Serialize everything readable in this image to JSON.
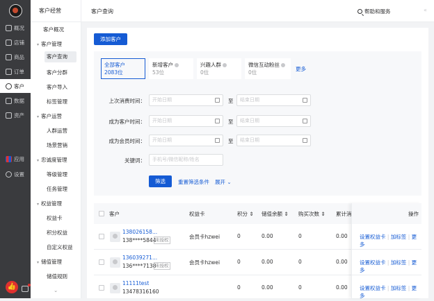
{
  "rail": {
    "items": [
      {
        "label": "概况",
        "icon": "monitor-icon"
      },
      {
        "label": "店铺",
        "icon": "store-icon"
      },
      {
        "label": "商品",
        "icon": "tag-icon"
      },
      {
        "label": "订单",
        "icon": "order-icon"
      },
      {
        "label": "客户",
        "icon": "user-icon"
      },
      {
        "label": "数据",
        "icon": "chart-icon"
      },
      {
        "label": "资产",
        "icon": "asset-icon"
      },
      {
        "label": "应用",
        "icon": "apps-icon"
      },
      {
        "label": "设置",
        "icon": "gear-icon"
      }
    ],
    "active": "客户"
  },
  "sub": {
    "title": "客户经营",
    "overview": "客户概况",
    "groups": [
      {
        "label": "客户管理",
        "items": [
          "客户查询",
          "客户分群",
          "客户导入",
          "标签管理"
        ]
      },
      {
        "label": "客户运营",
        "items": [
          "人群运营",
          "场景营销"
        ]
      },
      {
        "label": "忠诚度管理",
        "items": [
          "等级管理",
          "任务管理"
        ]
      },
      {
        "label": "权益管理",
        "items": [
          "权益卡",
          "积分权益",
          "自定义权益"
        ]
      },
      {
        "label": "储值管理",
        "items": [
          "储值规则"
        ]
      }
    ],
    "selected": "客户查询"
  },
  "topbar": {
    "title": "客户查询",
    "help": "帮助和服务"
  },
  "main": {
    "add_button": "添加客户",
    "cards": [
      {
        "label": "全部客户",
        "value": "2083位"
      },
      {
        "label": "新增客户",
        "value": "53位"
      },
      {
        "label": "兴趣人群",
        "value": "0位"
      },
      {
        "label": "微信互动粉丝",
        "value": "0位"
      }
    ],
    "more": "更多",
    "filters": {
      "last_purchase": "上次消费时间：",
      "became_customer": "成为客户时间：",
      "became_member": "成为会员时间：",
      "keyword": "关键词：",
      "start_placeholder": "开始日期",
      "end_placeholder": "结束日期",
      "to": "至",
      "keyword_placeholder": "手机号/微信昵称/姓名"
    },
    "search_button": "筛选",
    "reset_link": "重置筛选条件",
    "expand_link": "展开 ⌄"
  },
  "table": {
    "headers": {
      "customer": "客户",
      "card": "权益卡",
      "points": "积分 ⇕",
      "balance": "储值余额 ⇕",
      "count": "购买次数 ⇕",
      "total": "累计消",
      "ops": "操作"
    },
    "rows": [
      {
        "name": "138026158...",
        "phone": "138****5844",
        "tag": "未授权",
        "card": "会员卡hzwei",
        "points": "0",
        "balance": "0.00",
        "count": "0",
        "total": "0.00"
      },
      {
        "name": "136039271...",
        "phone": "136****7138",
        "tag": "未授权",
        "card": "会员卡hzwei",
        "points": "0",
        "balance": "0.00",
        "count": "0",
        "total": "0.00"
      },
      {
        "name": "11111test",
        "phone": "13478316160",
        "tag": "",
        "card": "",
        "points": "0",
        "balance": "0.00",
        "count": "0",
        "total": "0.00"
      }
    ],
    "op_labels": {
      "set_card": "设置权益卡",
      "add_tag": "加标签",
      "more": "更多"
    }
  }
}
